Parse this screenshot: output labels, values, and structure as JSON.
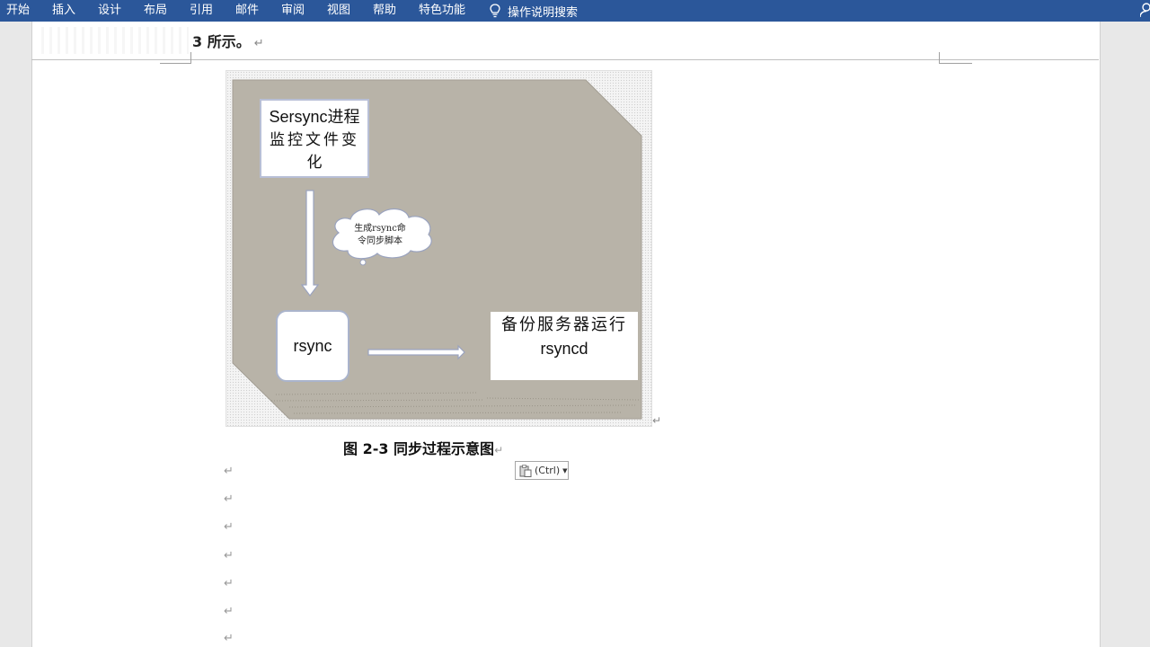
{
  "ribbon": {
    "tabs": [
      "开始",
      "插入",
      "设计",
      "布局",
      "引用",
      "邮件",
      "审阅",
      "视图",
      "帮助",
      "特色功能"
    ],
    "tell_me": "操作说明搜索"
  },
  "document": {
    "top_line": "3 所示。",
    "figure": {
      "sersync_box": [
        "Sersync进程",
        "监控文件变",
        "化"
      ],
      "cloud": [
        "生成rsync命",
        "令同步脚本"
      ],
      "rsync_box": "rsync",
      "rsyncd_box": [
        "备份服务器运行",
        "rsyncd"
      ]
    },
    "caption": "图 2-3  同步过程示意图",
    "paragraph_mark": "↵",
    "paste_options": "(Ctrl)"
  },
  "colors": {
    "ribbon_bg": "#2b579a",
    "figure_panel": "#b8b3a8",
    "box_border": "#b8bfd6"
  }
}
